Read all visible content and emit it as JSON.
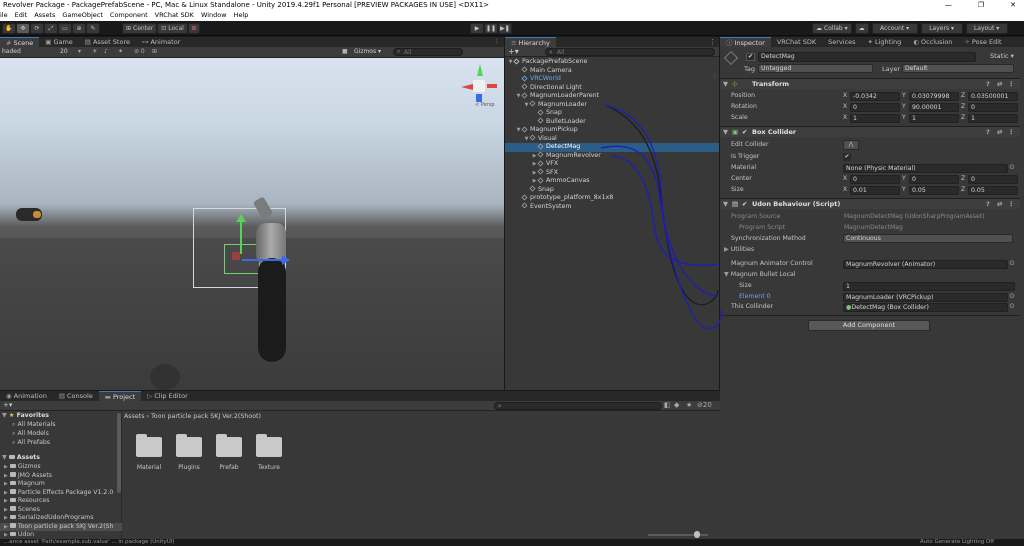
{
  "window": {
    "title": "Revolver Package - PackagePrefabScene - PC, Mac & Linux Standalone - Unity 2019.4.29f1 Personal [PREVIEW PACKAGES IN USE] <DX11>",
    "controls": [
      "—",
      "❐",
      "✕"
    ]
  },
  "menu": [
    "ile",
    "Edit",
    "Assets",
    "GameObject",
    "Component",
    "VRChat SDK",
    "Window",
    "Help"
  ],
  "toolbar": {
    "center_label": "Center",
    "local_label": "Local",
    "collab_label": "Collab ▾",
    "account_label": "Account ▾",
    "layers_label": "Layers ▾",
    "layout_label": "Layout ▾"
  },
  "scene": {
    "tabs": [
      "Scene",
      "Game",
      "Asset Store",
      "Animator"
    ],
    "shading_mode": "haded",
    "gizmos_label": "Gizmos ▾",
    "search_placeholder": "All",
    "persp_label": "< Persp",
    "counter": "20"
  },
  "hierarchy": {
    "tab": "Hierarchy",
    "search_placeholder": "All",
    "items": [
      {
        "label": "PackagePrefabScene",
        "depth": 0,
        "arrow": "▼",
        "type": "scene"
      },
      {
        "label": "Main Camera",
        "depth": 1,
        "arrow": "",
        "type": "obj"
      },
      {
        "label": "VRCWorld",
        "depth": 1,
        "arrow": "",
        "type": "prefab"
      },
      {
        "label": "Directional Light",
        "depth": 1,
        "arrow": "",
        "type": "obj"
      },
      {
        "label": "MagnumLoaderParent",
        "depth": 1,
        "arrow": "▼",
        "type": "obj"
      },
      {
        "label": "MagnumLoader",
        "depth": 2,
        "arrow": "▼",
        "type": "obj"
      },
      {
        "label": "Snap",
        "depth": 3,
        "arrow": "",
        "type": "obj"
      },
      {
        "label": "BulletLoader",
        "depth": 3,
        "arrow": "",
        "type": "obj"
      },
      {
        "label": "MagnumPickup",
        "depth": 1,
        "arrow": "▼",
        "type": "obj"
      },
      {
        "label": "Visual",
        "depth": 2,
        "arrow": "▼",
        "type": "obj"
      },
      {
        "label": "DetectMag",
        "depth": 3,
        "arrow": "",
        "type": "obj",
        "selected": true
      },
      {
        "label": "MagnumRevolver",
        "depth": 3,
        "arrow": "▶",
        "type": "obj"
      },
      {
        "label": "VFX",
        "depth": 3,
        "arrow": "▶",
        "type": "obj"
      },
      {
        "label": "SFX",
        "depth": 3,
        "arrow": "▶",
        "type": "obj"
      },
      {
        "label": "AmmoCanvas",
        "depth": 3,
        "arrow": "▶",
        "type": "obj"
      },
      {
        "label": "Snap",
        "depth": 2,
        "arrow": "",
        "type": "obj"
      },
      {
        "label": "prototype_platform_8x1x8",
        "depth": 1,
        "arrow": "",
        "type": "obj"
      },
      {
        "label": "EventSystem",
        "depth": 1,
        "arrow": "",
        "type": "obj"
      }
    ]
  },
  "inspector": {
    "tabs": [
      "Inspector",
      "VRChat SDK",
      "Services",
      "Lighting",
      "Occlusion",
      "Pose Edit"
    ],
    "object_name": "DetectMag",
    "static_label": "Static ▾",
    "tag_label": "Tag",
    "tag_value": "Untagged",
    "layer_label": "Layer",
    "layer_value": "Default",
    "transform": {
      "title": "Transform",
      "position_label": "Position",
      "rotation_label": "Rotation",
      "scale_label": "Scale",
      "position": {
        "x": "-0.0342",
        "y": "0.03079998",
        "z": "0.03500001"
      },
      "rotation": {
        "x": "0",
        "y": "90.00001",
        "z": "0"
      },
      "scale": {
        "x": "1",
        "y": "1",
        "z": "1"
      }
    },
    "box_collider": {
      "title": "Box Collider",
      "edit_collider_label": "Edit Collider",
      "is_trigger_label": "Is Trigger",
      "is_trigger_value": "✔",
      "material_label": "Material",
      "material_value": "None (Physic Material)",
      "center_label": "Center",
      "center": {
        "x": "0",
        "y": "0",
        "z": "0"
      },
      "size_label": "Size",
      "size": {
        "x": "0.01",
        "y": "0.05",
        "z": "0.05"
      }
    },
    "udon": {
      "title": "Udon Behaviour (Script)",
      "program_source_label": "Program Source",
      "program_source_value": "MagnumDetectMag (UdonSharpProgramAsset)",
      "program_script_label": "Program Script",
      "program_script_value": "MagnumDetectMag",
      "sync_label": "Synchronization Method",
      "sync_value": "Continuous",
      "utilities_label": "Utilities",
      "animator_label": "Magnum Animator Control",
      "animator_value": "MagnumRevolver (Animator)",
      "bullet_local_label": "Magnum Bullet Local",
      "size_label": "Size",
      "size_value": "1",
      "element_label": "Element 0",
      "element_value": "MagnumLoader (VRCPickup)",
      "this_collider_label": "This Collinder",
      "this_collider_value": "DetectMag (Box Collider)"
    },
    "add_component_label": "Add Component"
  },
  "project": {
    "tabs": [
      "Animation",
      "Console",
      "Project",
      "Clip Editor"
    ],
    "breadcrumb": "Assets › Toon particle pack SKJ Ver.2(Shoot)",
    "hidden_count": "20",
    "favorites_label": "Favorites",
    "favorites": [
      "All Materials",
      "All Models",
      "All Prefabs"
    ],
    "assets_label": "Assets",
    "tree": [
      "Gizmos",
      "JMO Assets",
      "Magnum",
      "Particle Effects Package V1.2.0",
      "Resources",
      "Scenes",
      "SerializedUdonPrograms",
      "Toon particle pack SKJ Ver.2(Sh",
      "Udon"
    ],
    "folders": [
      "Material",
      "Plugins",
      "Prefab",
      "Texture"
    ]
  },
  "status": {
    "left": "...ance asset 'Path/example.sub.value' ... in package (UnityUI)",
    "right": "Auto Generate Lighting Off"
  },
  "colors": {
    "selection": "#2c5d87",
    "ink": "#1d1db8",
    "accent_tab": "#3a79bb"
  }
}
